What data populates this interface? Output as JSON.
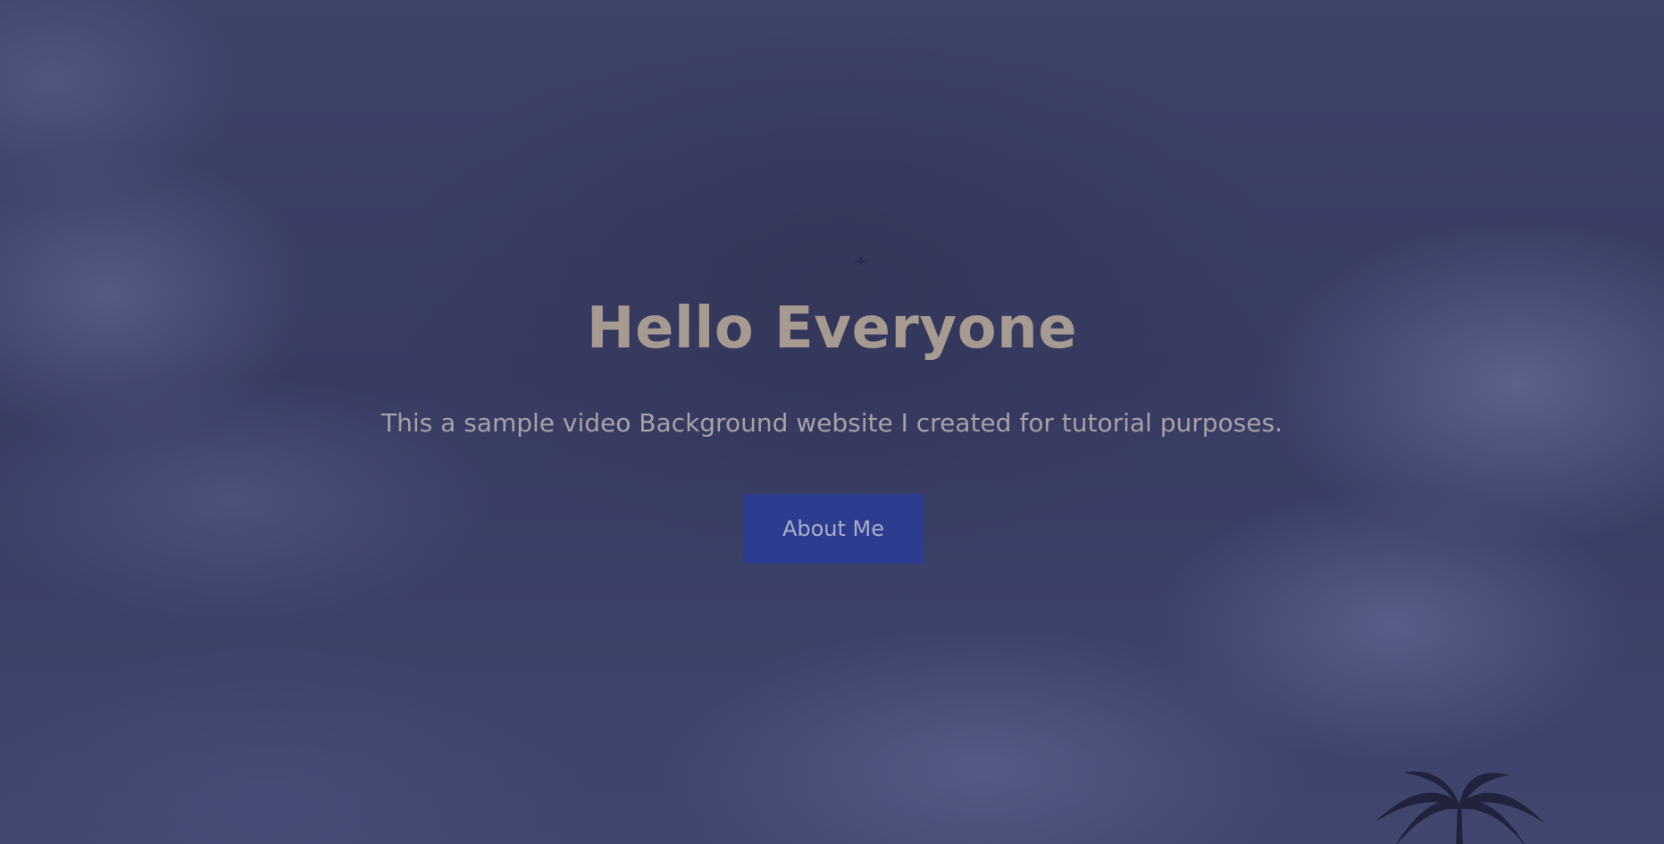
{
  "hero": {
    "title": "Hello Everyone",
    "subtitle": "This a sample video Background website I created for tutorial purposes.",
    "button_label": "About Me",
    "background": "video-background-cloudy-sky",
    "decorations": [
      "palm-tree-silhouette",
      "bird-icon"
    ]
  },
  "colors": {
    "title": "#a79a91",
    "subtitle": "#a7a1a6",
    "button_bg": "#2e3c8f",
    "button_text": "#a7aecb",
    "sky": "#3d4266"
  }
}
